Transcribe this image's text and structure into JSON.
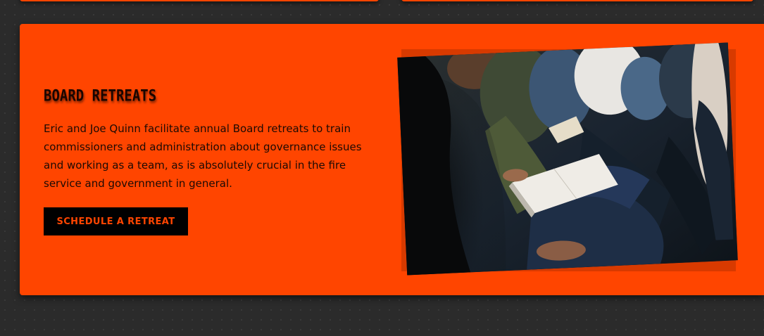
{
  "board_retreats": {
    "title": "BOARD RETREATS",
    "description": "Eric and Joe Quinn facilitate annual Board retreats to train commissioners and administration about governance issues and working as a team, as is absolutely crucial in the fire service and government in general.",
    "cta_label": "SCHEDULE A RETREAT",
    "photo_subject": "audience-taking-notes-photo"
  },
  "colors": {
    "accent": "#ff4500",
    "background": "#2b2b2b",
    "button_bg": "#000000",
    "button_text": "#ff4500"
  }
}
